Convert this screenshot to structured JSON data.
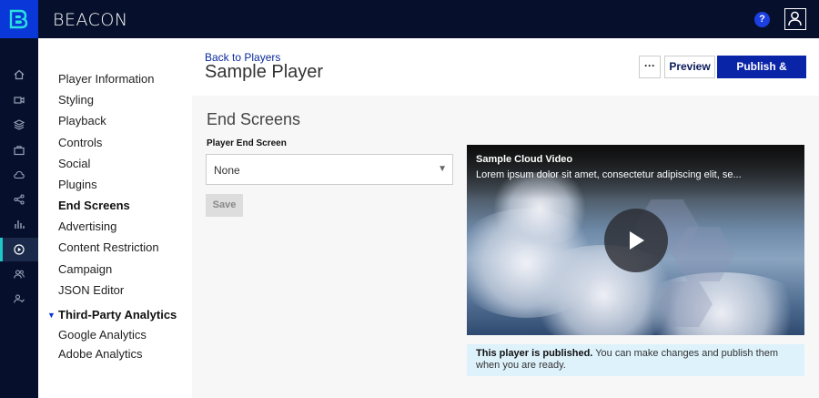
{
  "app": {
    "brand": "BEACON",
    "help_label": "?"
  },
  "subnav": {
    "items": [
      {
        "label": "Player Information"
      },
      {
        "label": "Styling"
      },
      {
        "label": "Playback"
      },
      {
        "label": "Controls"
      },
      {
        "label": "Social"
      },
      {
        "label": "Plugins"
      },
      {
        "label": "End Screens",
        "active": true
      },
      {
        "label": "Advertising"
      },
      {
        "label": "Content Restriction"
      },
      {
        "label": "Campaign"
      },
      {
        "label": "JSON Editor"
      }
    ],
    "group_label": "Third-Party Analytics",
    "group_items": [
      {
        "label": "Google Analytics"
      },
      {
        "label": "Adobe Analytics"
      }
    ]
  },
  "rail": {
    "icons": [
      "home-icon",
      "video-camera-icon",
      "layers-icon",
      "briefcase-icon",
      "cloud-icon",
      "share-icon",
      "bar-chart-icon",
      "play-circle-icon",
      "users-icon",
      "user-check-icon"
    ],
    "active_index": 7
  },
  "header": {
    "back_link": "Back to Players",
    "title": "Sample Player",
    "more_label": "···",
    "preview_label": "Preview",
    "publish_label": "Publish & Embed"
  },
  "main": {
    "section_title": "End Screens",
    "field_label": "Player End Screen",
    "select_value": "None",
    "save_label": "Save"
  },
  "video": {
    "title": "Sample Cloud Video",
    "description": "Lorem ipsum dolor sit amet, consectetur adipiscing elit, se..."
  },
  "notice": {
    "strong": "This player is published.",
    "text": " You can make changes and publish them when you are ready."
  },
  "colors": {
    "topbar": "#06102c",
    "logo": "#0a38d8",
    "primary_button": "#0a24a8",
    "active_rail_accent": "#1ec8c8",
    "notice_bg": "#def2fb"
  }
}
